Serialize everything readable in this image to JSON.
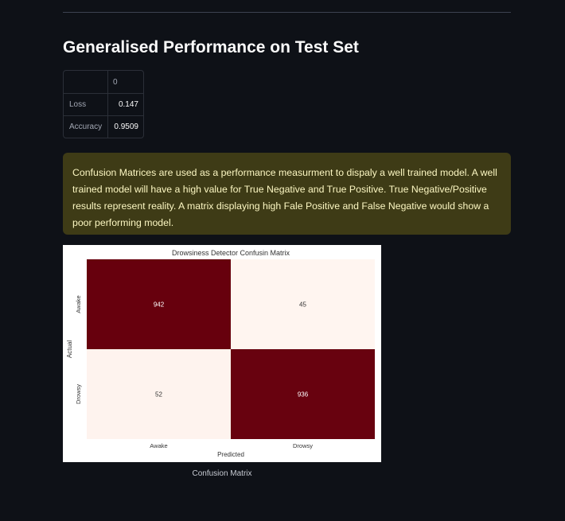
{
  "page": {
    "title": "Generalised Performance on Test Set"
  },
  "metrics_table": {
    "column_header": "0",
    "rows": [
      {
        "label": "Loss",
        "value": "0.147"
      },
      {
        "label": "Accuracy",
        "value": "0.9509"
      }
    ]
  },
  "info": {
    "text": "Confusion Matrices are used as a performance measurment to dispaly a well trained model. A well trained model will have a high value for True Negative and True Positive. True Negative/Positive results represent reality. A matrix displaying high Fale Positive and False Negative would show a poor performing model."
  },
  "figure": {
    "caption": "Confusion Matrix"
  },
  "colors": {
    "background": "#0e1117",
    "info_bg": "#3e3b16",
    "info_text": "#fcf7c2",
    "heatmap_high": "#67000d",
    "heatmap_low": "#fff5f0"
  },
  "chart_data": {
    "type": "heatmap",
    "title": "Drowsiness Detector Confusin Matrix",
    "xlabel": "Predicted",
    "ylabel": "Actual",
    "x_categories": [
      "Awake",
      "Drowsy"
    ],
    "y_categories": [
      "Awake",
      "Drowsy"
    ],
    "values": [
      [
        942,
        45
      ],
      [
        52,
        936
      ]
    ],
    "colormap": "Reds",
    "colorbar": false
  }
}
